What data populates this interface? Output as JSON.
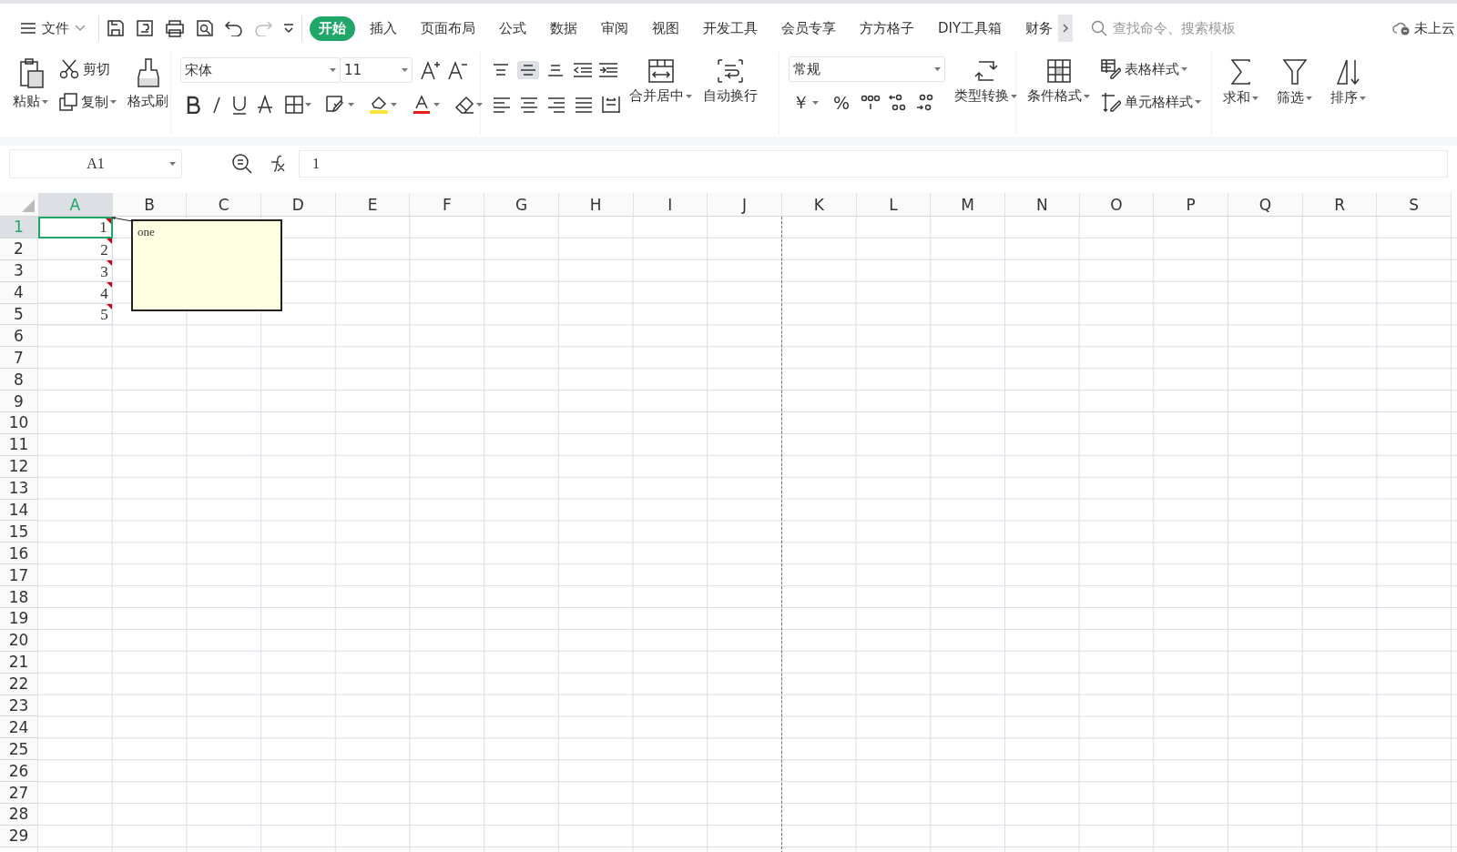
{
  "menu": {
    "file_label": "文件",
    "tabs": [
      {
        "label": "开始",
        "selected": true
      },
      {
        "label": "插入",
        "selected": false
      },
      {
        "label": "页面布局",
        "selected": false
      },
      {
        "label": "公式",
        "selected": false
      },
      {
        "label": "数据",
        "selected": false
      },
      {
        "label": "审阅",
        "selected": false
      },
      {
        "label": "视图",
        "selected": false
      },
      {
        "label": "开发工具",
        "selected": false
      },
      {
        "label": "会员专享",
        "selected": false
      },
      {
        "label": "方方格子",
        "selected": false
      },
      {
        "label": "DIY工具箱",
        "selected": false
      },
      {
        "label": "财务",
        "selected": false
      }
    ],
    "search": {
      "placeholder": "查找命令、搜索模板"
    },
    "cloud_status": "未上云"
  },
  "ribbon": {
    "paste": "粘贴",
    "cut": "剪切",
    "copy": "复制",
    "format_painter": "格式刷",
    "font": "宋体",
    "font_size": "11",
    "vertical_align": [
      {
        "selected": false
      },
      {
        "selected": true
      },
      {
        "selected": false
      }
    ],
    "merge": "合并居中",
    "wrap": "自动换行",
    "number_format": "常规",
    "currency": "￥",
    "percent": "%",
    "convert": "类型转换",
    "conditional_format": "条件格式",
    "table_style": "表格样式",
    "cell_style": "单元格样式",
    "sum": "求和",
    "filter": "筛选",
    "sort": "排序"
  },
  "formula_bar": {
    "name_box": "A1",
    "formula": "1"
  },
  "sheet": {
    "columns": [
      {
        "label": "A",
        "selected": true
      },
      {
        "label": "B",
        "selected": false
      },
      {
        "label": "C",
        "selected": false
      },
      {
        "label": "D",
        "selected": false
      },
      {
        "label": "E",
        "selected": false
      },
      {
        "label": "F",
        "selected": false
      },
      {
        "label": "G",
        "selected": false
      },
      {
        "label": "H",
        "selected": false
      },
      {
        "label": "I",
        "selected": false
      },
      {
        "label": "J",
        "selected": false
      },
      {
        "label": "K",
        "selected": false
      },
      {
        "label": "L",
        "selected": false
      },
      {
        "label": "M",
        "selected": false
      },
      {
        "label": "N",
        "selected": false
      },
      {
        "label": "O",
        "selected": false
      },
      {
        "label": "P",
        "selected": false
      },
      {
        "label": "Q",
        "selected": false
      },
      {
        "label": "R",
        "selected": false
      },
      {
        "label": "S",
        "selected": false
      }
    ],
    "rows": [
      {
        "label": "1",
        "selected": true,
        "value": "1",
        "has_comment": true
      },
      {
        "label": "2",
        "selected": false,
        "value": "2",
        "has_comment": true
      },
      {
        "label": "3",
        "selected": false,
        "value": "3",
        "has_comment": true
      },
      {
        "label": "4",
        "selected": false,
        "value": "4",
        "has_comment": true
      },
      {
        "label": "5",
        "selected": false,
        "value": "5",
        "has_comment": true
      },
      {
        "label": "6",
        "selected": false
      },
      {
        "label": "7",
        "selected": false
      },
      {
        "label": "8",
        "selected": false
      },
      {
        "label": "9",
        "selected": false
      },
      {
        "label": "10",
        "selected": false
      },
      {
        "label": "11",
        "selected": false
      },
      {
        "label": "12",
        "selected": false
      },
      {
        "label": "13",
        "selected": false
      },
      {
        "label": "14",
        "selected": false
      },
      {
        "label": "15",
        "selected": false
      },
      {
        "label": "16",
        "selected": false
      },
      {
        "label": "17",
        "selected": false
      },
      {
        "label": "18",
        "selected": false
      },
      {
        "label": "19",
        "selected": false
      },
      {
        "label": "20",
        "selected": false
      },
      {
        "label": "21",
        "selected": false
      },
      {
        "label": "22",
        "selected": false
      },
      {
        "label": "23",
        "selected": false
      },
      {
        "label": "24",
        "selected": false
      },
      {
        "label": "25",
        "selected": false
      },
      {
        "label": "26",
        "selected": false
      },
      {
        "label": "27",
        "selected": false
      },
      {
        "label": "28",
        "selected": false
      },
      {
        "label": "29",
        "selected": false
      }
    ],
    "comment": {
      "text": "one"
    }
  }
}
